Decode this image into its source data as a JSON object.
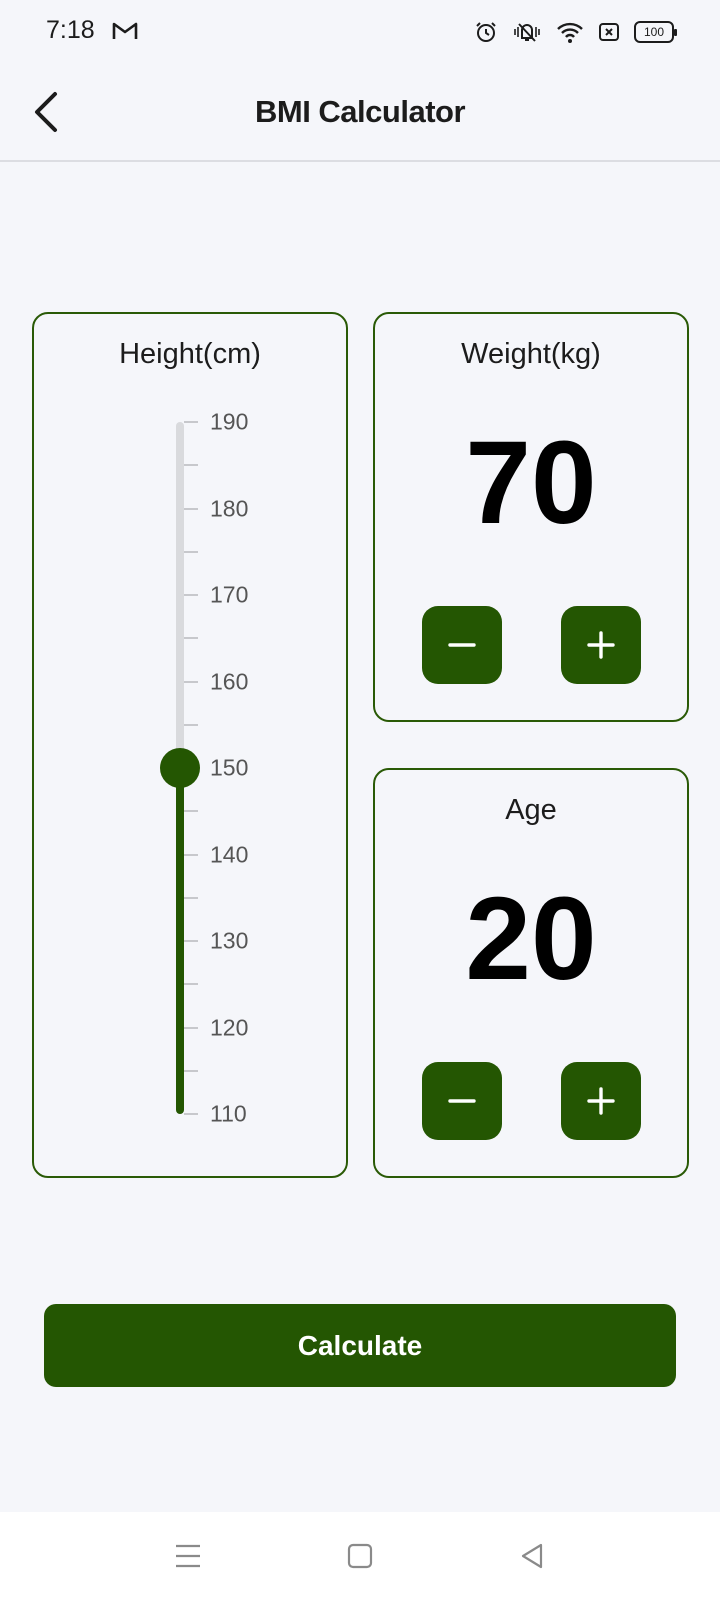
{
  "status_bar": {
    "time": "7:18",
    "battery": "100",
    "icons": [
      "gmail-icon",
      "alarm-icon",
      "vibrate-off-icon",
      "wifi-icon",
      "no-sim-icon",
      "battery-icon"
    ]
  },
  "app_bar": {
    "title": "BMI Calculator",
    "back_icon": "chevron-left-icon"
  },
  "height_card": {
    "title": "Height(cm)",
    "value": 150,
    "min": 110,
    "max": 190,
    "tick_labels": [
      "190",
      "180",
      "170",
      "160",
      "150",
      "140",
      "130",
      "120",
      "110"
    ]
  },
  "weight_card": {
    "title": "Weight(kg)",
    "value": "70",
    "minus_icon": "minus-icon",
    "plus_icon": "plus-icon"
  },
  "age_card": {
    "title": "Age",
    "value": "20",
    "minus_icon": "minus-icon",
    "plus_icon": "plus-icon"
  },
  "calculate_button": {
    "label": "Calculate"
  },
  "nav_bar": {
    "icons": [
      "menu-icon",
      "home-icon",
      "back-icon"
    ]
  },
  "colors": {
    "accent": "#245602",
    "background": "#f5f6fa",
    "track": "#d9dadd"
  }
}
